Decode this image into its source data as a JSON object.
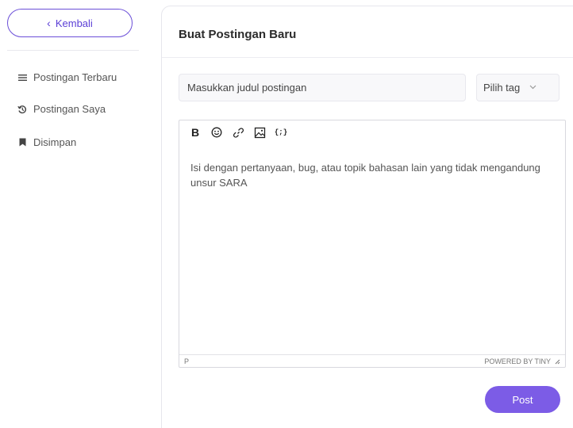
{
  "sidebar": {
    "back_label": "Kembali",
    "items": [
      {
        "label": "Postingan Terbaru",
        "icon": "menu-icon"
      },
      {
        "label": "Postingan Saya",
        "icon": "history-icon"
      },
      {
        "label": "Disimpan",
        "icon": "bookmark-icon"
      }
    ]
  },
  "main": {
    "title": "Buat Postingan Baru",
    "title_input": {
      "value": "",
      "placeholder": "Masukkan judul postingan"
    },
    "tag_select": {
      "selected": "Pilih tag"
    },
    "editor": {
      "toolbar": [
        {
          "name": "bold",
          "glyph": "B"
        },
        {
          "name": "emoji"
        },
        {
          "name": "link"
        },
        {
          "name": "image"
        },
        {
          "name": "code",
          "glyph": "{;}"
        }
      ],
      "placeholder": "Isi dengan pertanyaan, bug, atau topik bahasan lain yang tidak mengandung unsur SARA",
      "status_path": "P",
      "powered_by": "POWERED BY TINY"
    },
    "post_label": "Post"
  },
  "colors": {
    "accent": "#7c5ce6",
    "accent_text": "#5b3fd6"
  }
}
